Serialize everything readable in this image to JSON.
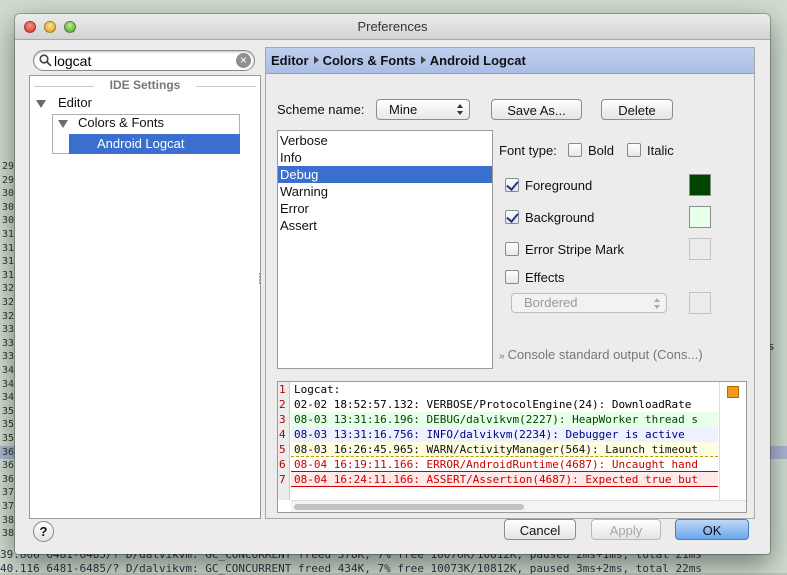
{
  "window": {
    "title": "Preferences"
  },
  "search": {
    "value": "logcat"
  },
  "tree": {
    "section": "IDE Settings",
    "editor": "Editor",
    "colors_fonts": "Colors & Fonts",
    "android_logcat": "Android Logcat"
  },
  "breadcrumb": [
    "Editor",
    "Colors & Fonts",
    "Android Logcat"
  ],
  "scheme": {
    "label": "Scheme name:",
    "value": "Mine",
    "save_as": "Save As...",
    "delete": "Delete"
  },
  "levels": [
    "Verbose",
    "Info",
    "Debug",
    "Warning",
    "Error",
    "Assert"
  ],
  "selected_level": "Debug",
  "font_type": {
    "label": "Font type:",
    "bold": "Bold",
    "italic": "Italic"
  },
  "attributes": {
    "foreground": {
      "label": "Foreground",
      "checked": true,
      "color": "#004400"
    },
    "background": {
      "label": "Background",
      "checked": true,
      "color": "#E8FFEA"
    },
    "error_stripe": {
      "label": "Error Stripe Mark",
      "checked": false
    },
    "effects": {
      "label": "Effects",
      "checked": false,
      "select_value": "Bordered"
    }
  },
  "console_link": "Console standard output (Cons...)",
  "preview": {
    "line_numbers": [
      "1",
      "2",
      "3",
      "4",
      "5",
      "6",
      "7"
    ],
    "lines": [
      "Logcat:",
      "02-02 18:52:57.132: VERBOSE/ProtocolEngine(24): DownloadRate",
      "08-03 13:31:16.196: DEBUG/dalvikvm(2227): HeapWorker thread s",
      "08-03 13:31:16.756: INFO/dalvikvm(2234): Debugger is active",
      "08-03 16:26:45.965: WARN/ActivityManager(564): Launch timeout",
      "08-04 16:19:11.166: ERROR/AndroidRuntime(4687): Uncaught hand",
      "08-04 16:24:11.166: ASSERT/Assertion(4687): Expected true but"
    ]
  },
  "footer": {
    "help": "?",
    "cancel": "Cancel",
    "apply": "Apply",
    "ok": "OK"
  },
  "background_log": {
    "gutter": [
      "29.",
      "29.",
      "30.",
      "30.",
      "30.",
      "31.",
      "31.",
      "31.",
      "31.",
      "32.",
      "32.",
      "32.",
      "33.",
      "33.",
      "33.",
      "34.",
      "34.",
      "34.",
      "35.",
      "35.",
      "35.",
      "36.",
      "36.",
      "36.",
      "37.",
      "37.",
      "38.",
      "38."
    ],
    "bottom_line_1": "39.806   6481-6485/? D/dalvikvm: GC_CONCURRENT freed 378K, 7% free 10076K/10812K, paused 2ms+1ms, total 21ms",
    "bottom_line_2": "40.116   6481-6485/? D/dalvikvm: GC_CONCURRENT freed 434K, 7% free 10073K/10812K, paused 3ms+2ms, total 22ms",
    "right_fragment": "s"
  }
}
